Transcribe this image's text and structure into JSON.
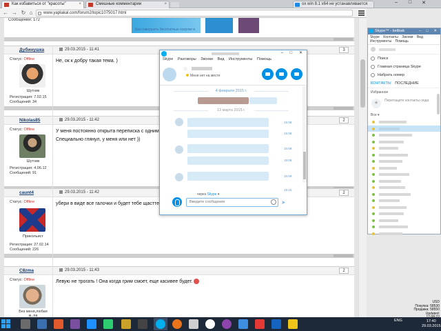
{
  "browser": {
    "tabs": [
      {
        "title": "Как избавиться от \"красоты\"",
        "active": true
      },
      {
        "title": "Смешные комментарии",
        "active": false
      }
    ],
    "right_tab": "ox win 8.1 x64 не устанавливается",
    "url": "www.yaplakal.com/forum2/topic1075017.html"
  },
  "forum": {
    "top_messages": "Сообщений: 172",
    "ad_link": "Как совершить бесплатные покупки в",
    "posts": [
      {
        "username": "Дубинушка",
        "date": "29.03.2015 - 11:41",
        "number": "3",
        "status_label": "Статус:",
        "status": "Offline",
        "rank": "Шутник",
        "registered": "Регистрация: 7.02.15",
        "messages": "Сообщений: 34",
        "text": [
          "Не, ок к добру такая тема. )"
        ]
      },
      {
        "username": "Nikolas85",
        "date": "29.03.2015 - 11:42",
        "number": "2",
        "status_label": "Статус:",
        "status": "Offline",
        "rank": "Шутник",
        "registered": "Регистрация: 4.06.12",
        "messages": "Сообщений: 91",
        "text": [
          "У меня постоянно открыта переписка с одним и",
          "Специально глянул, у меня или нет ))"
        ]
      },
      {
        "username": "caunt4",
        "date": "29.03.2015 - 11:42",
        "number": "2",
        "status_label": "Статус:",
        "status": "Offline",
        "rank": "Прикольист",
        "registered": "Регистрация: 27.02.14",
        "messages": "Сообщений: 226",
        "text": [
          "убери в виде все галочки и будет тебе щастте"
        ]
      },
      {
        "username": "C8zma",
        "date": "29.03.2015 - 11:43",
        "number": "2",
        "status_label": "Статус:",
        "status": "Offline",
        "rank": "Без меня,любая ж..па",
        "registered": "",
        "messages": "",
        "text": [
          "Левую не трогать ! Она когда грим смоет, еще касивее будет."
        ]
      }
    ]
  },
  "chat": {
    "menu": [
      "Skype",
      "Разговоры",
      "Звонки",
      "Вид",
      "Инструменты",
      "Помощь"
    ],
    "status": "Меня нет на месте",
    "date1": "4 февраля 2015 г.",
    "date2": "13 марта 2015 г.",
    "times": [
      "15:08",
      "15:08",
      "15:08",
      "15:08",
      "15:09",
      "15:15"
    ],
    "via_prefix": "через",
    "via_service": "Skype",
    "input_placeholder": "Введите сообщение"
  },
  "skype": {
    "title": "Skype™ - belibak",
    "menu": [
      "Skype",
      "Контакты",
      "Звонки",
      "Вид",
      "Инструменты",
      "Помощь"
    ],
    "search": "Поиск",
    "home": "Главная страница Skype",
    "dial": "Набрать номер",
    "tab_contacts": "КОНТАКТЫ",
    "tab_recent": "ПОСЛЕДНИЕ",
    "favorites_label": "Избранное",
    "favorites_hint": "Перетащите контакты сюда",
    "all_label": "Все ▾"
  },
  "currency": {
    "label": "USD",
    "buy": "Покупка: 58530",
    "sell": "Продажа: 58550",
    "updated": "Updated: 17:08:22"
  },
  "taskbar": {
    "lang": "ENG",
    "time": "17:40",
    "date": "29.03.2015"
  }
}
